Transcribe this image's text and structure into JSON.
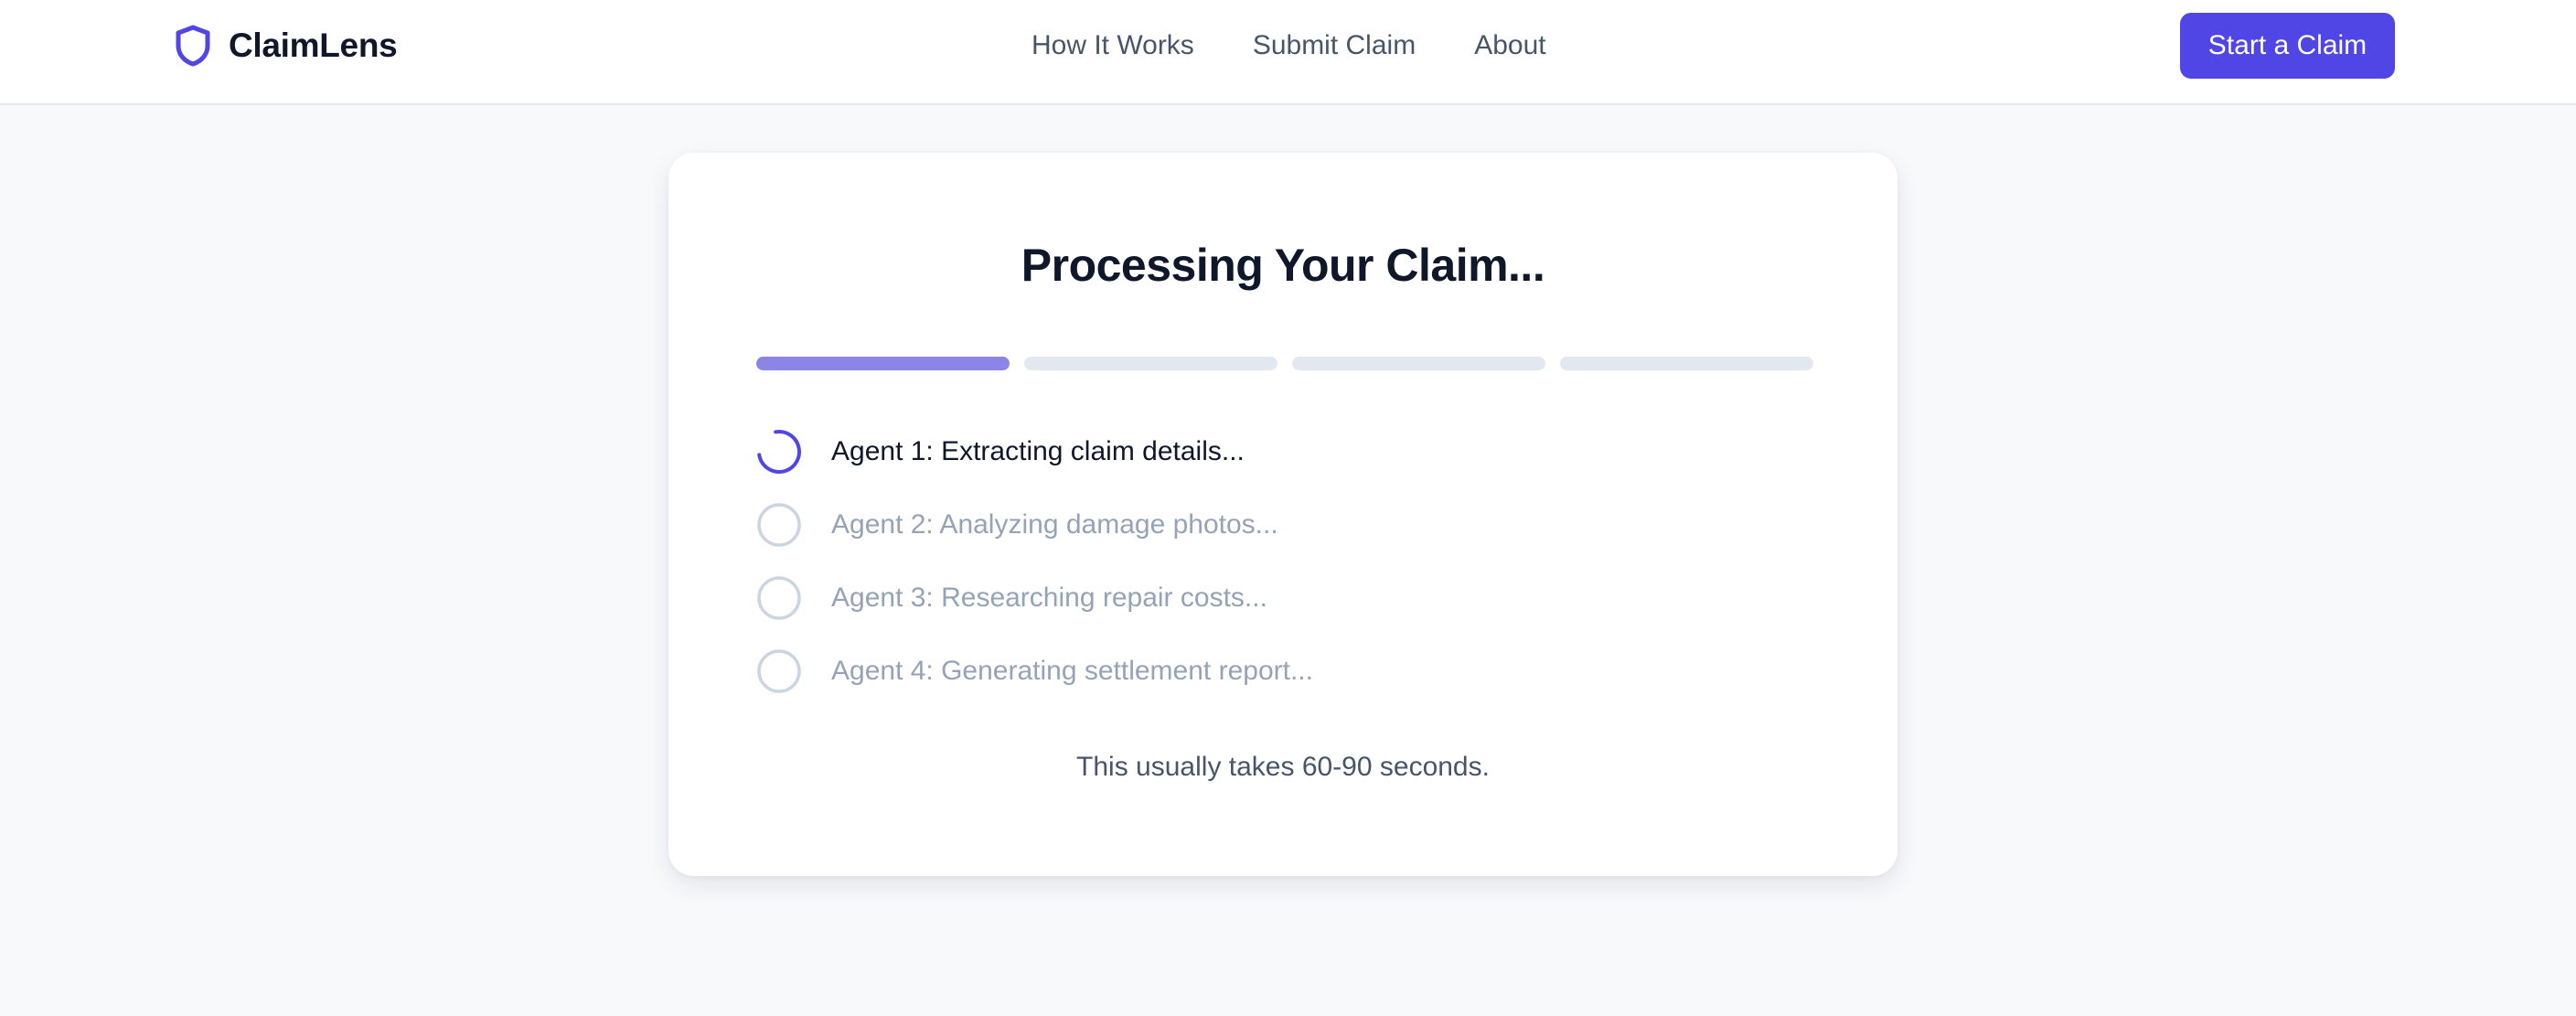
{
  "brand": {
    "name": "ClaimLens",
    "icon": "shield-icon",
    "accent_color": "#4f46e5"
  },
  "nav": {
    "links": [
      {
        "label": "How It Works"
      },
      {
        "label": "Submit Claim"
      },
      {
        "label": "About"
      }
    ],
    "cta_label": "Start a Claim"
  },
  "processing": {
    "title": "Processing Your Claim...",
    "progress": {
      "total_steps": 4,
      "completed_steps": 1,
      "active_color": "#8b85e8",
      "inactive_color": "#e2e8f0"
    },
    "agents": [
      {
        "label": "Agent 1: Extracting claim details...",
        "status": "in-progress",
        "icon": "spinner-icon"
      },
      {
        "label": "Agent 2: Analyzing damage photos...",
        "status": "pending",
        "icon": "pending-circle-icon"
      },
      {
        "label": "Agent 3: Researching repair costs...",
        "status": "pending",
        "icon": "pending-circle-icon"
      },
      {
        "label": "Agent 4: Generating settlement report...",
        "status": "pending",
        "icon": "pending-circle-icon"
      }
    ],
    "note": "This usually takes 60-90 seconds."
  }
}
